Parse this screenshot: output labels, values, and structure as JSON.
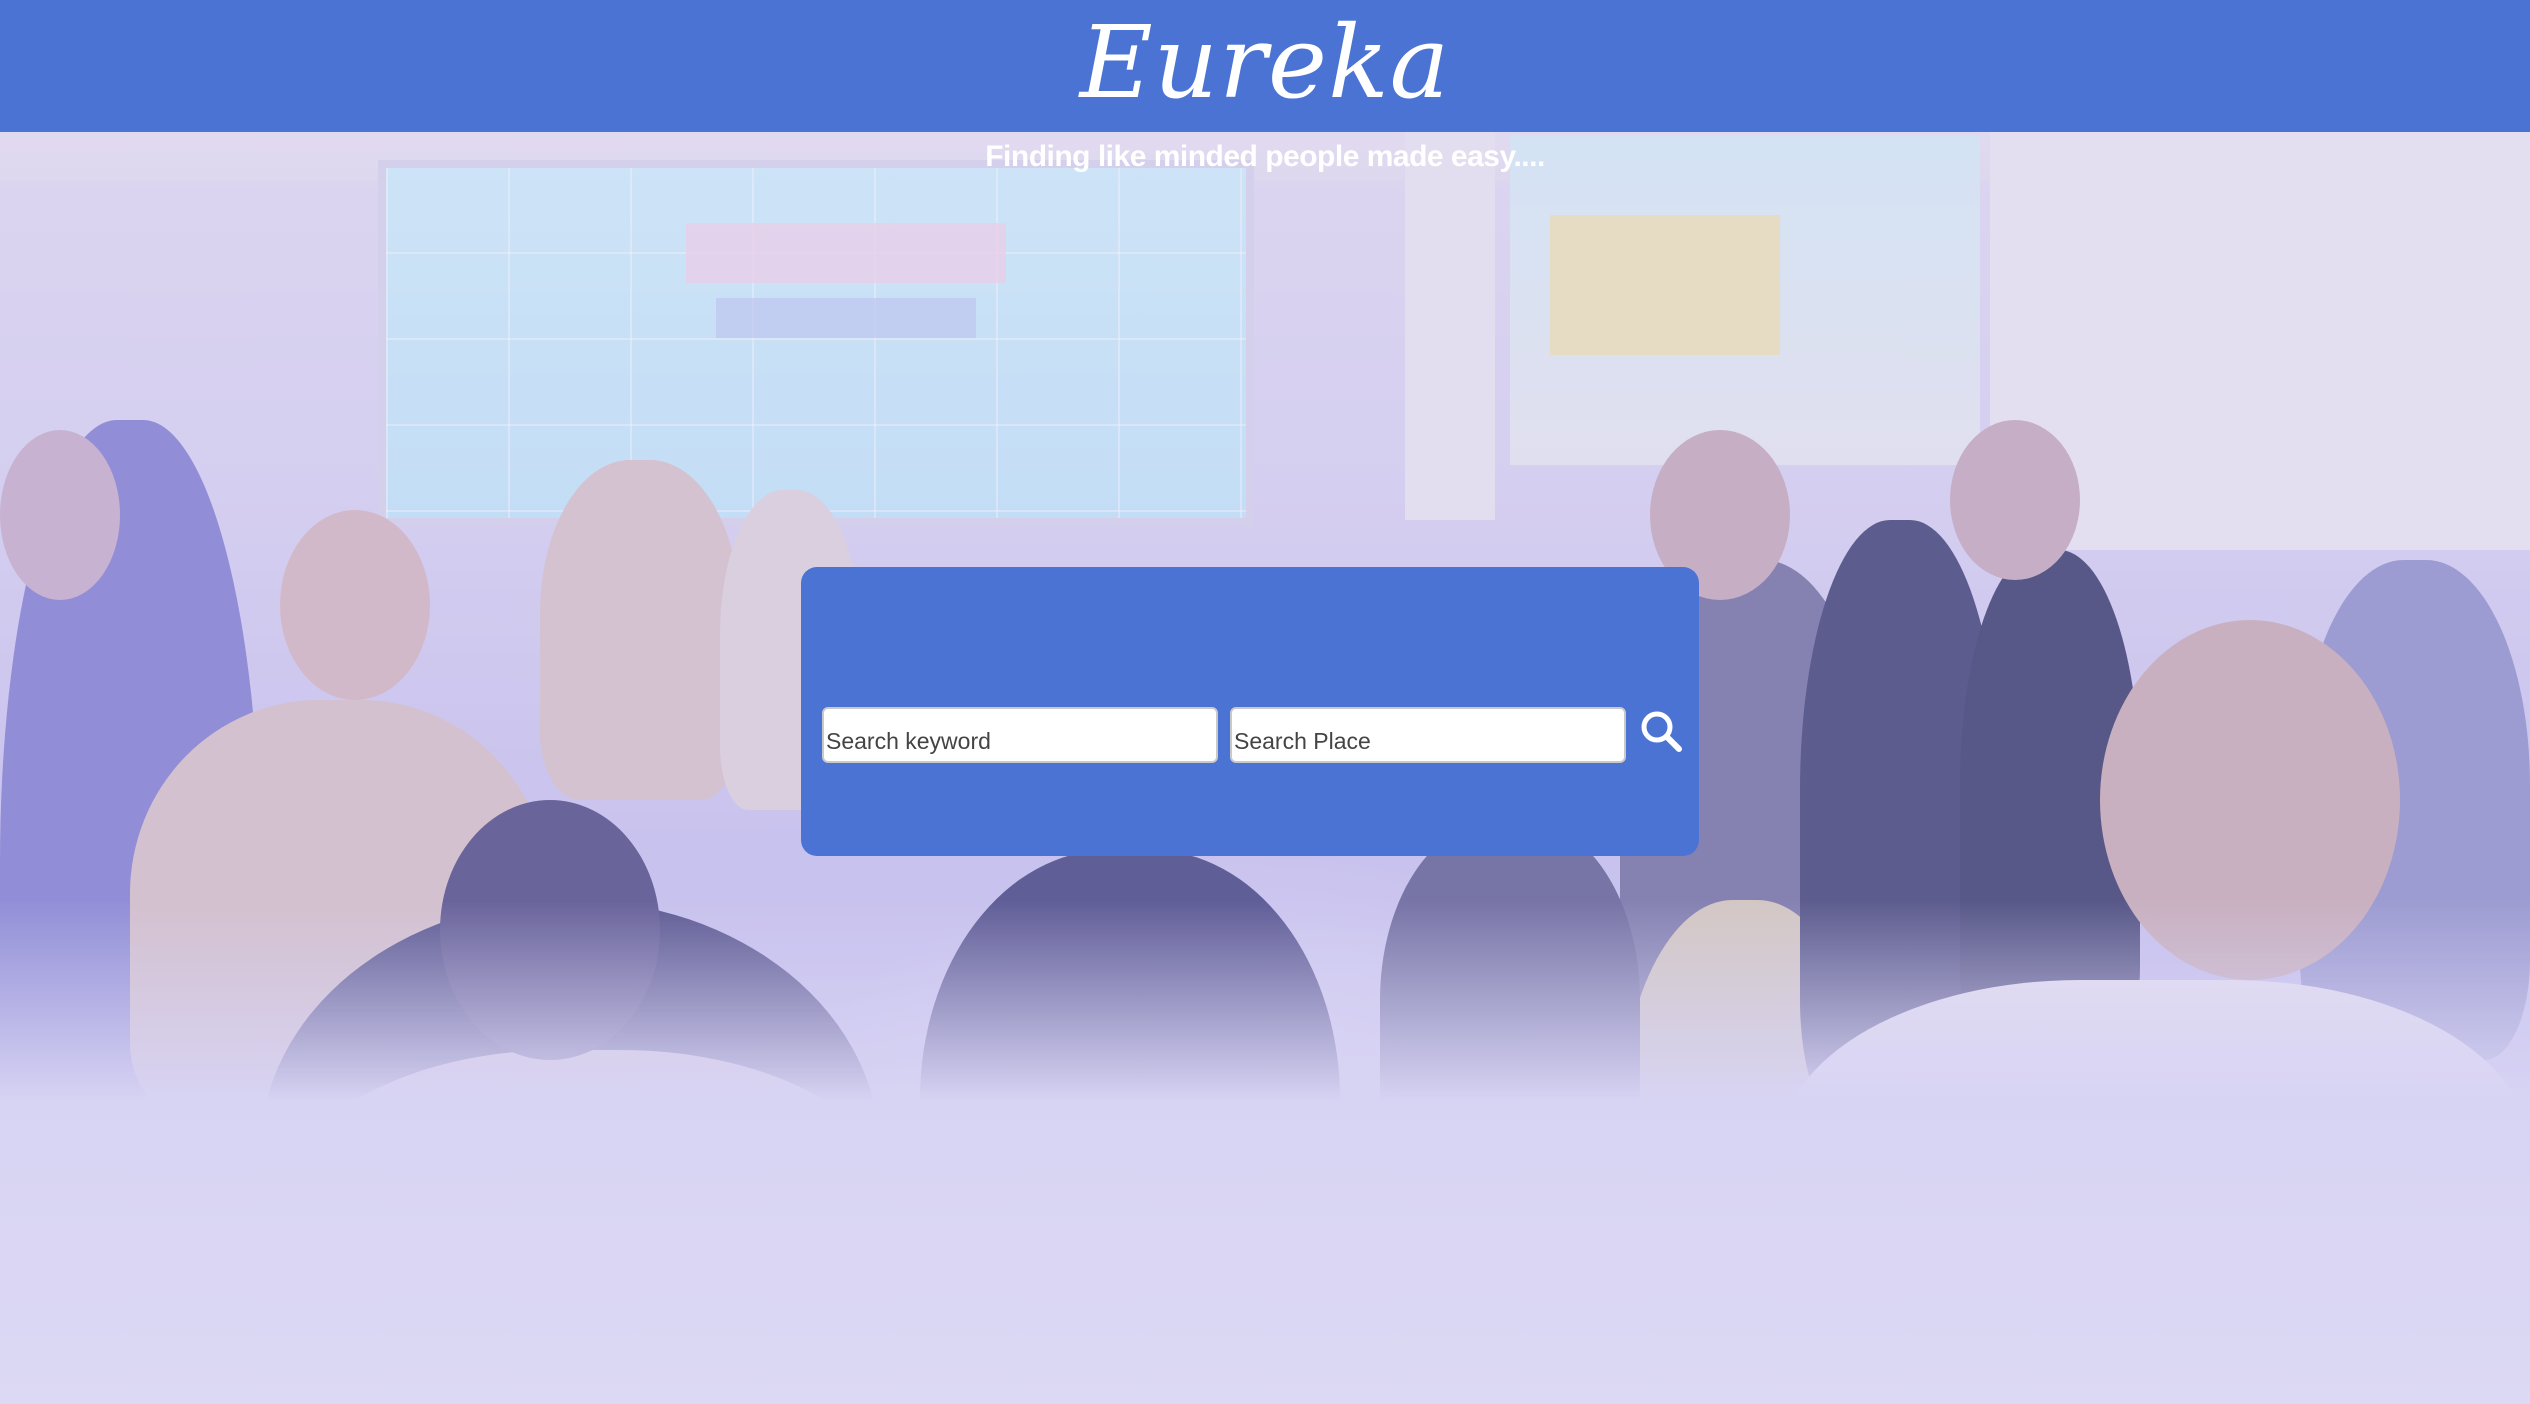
{
  "header": {
    "brand": "Eureka",
    "background_color": "#4a73d4"
  },
  "tagline": "Finding like minded people made easy....",
  "search": {
    "keyword_placeholder": "Search keyword",
    "keyword_value": "",
    "place_placeholder": "Search Place",
    "place_value": "",
    "button_icon": "search-icon"
  },
  "background": {
    "image": "photo of a crowded networking event with a presentation screen"
  }
}
